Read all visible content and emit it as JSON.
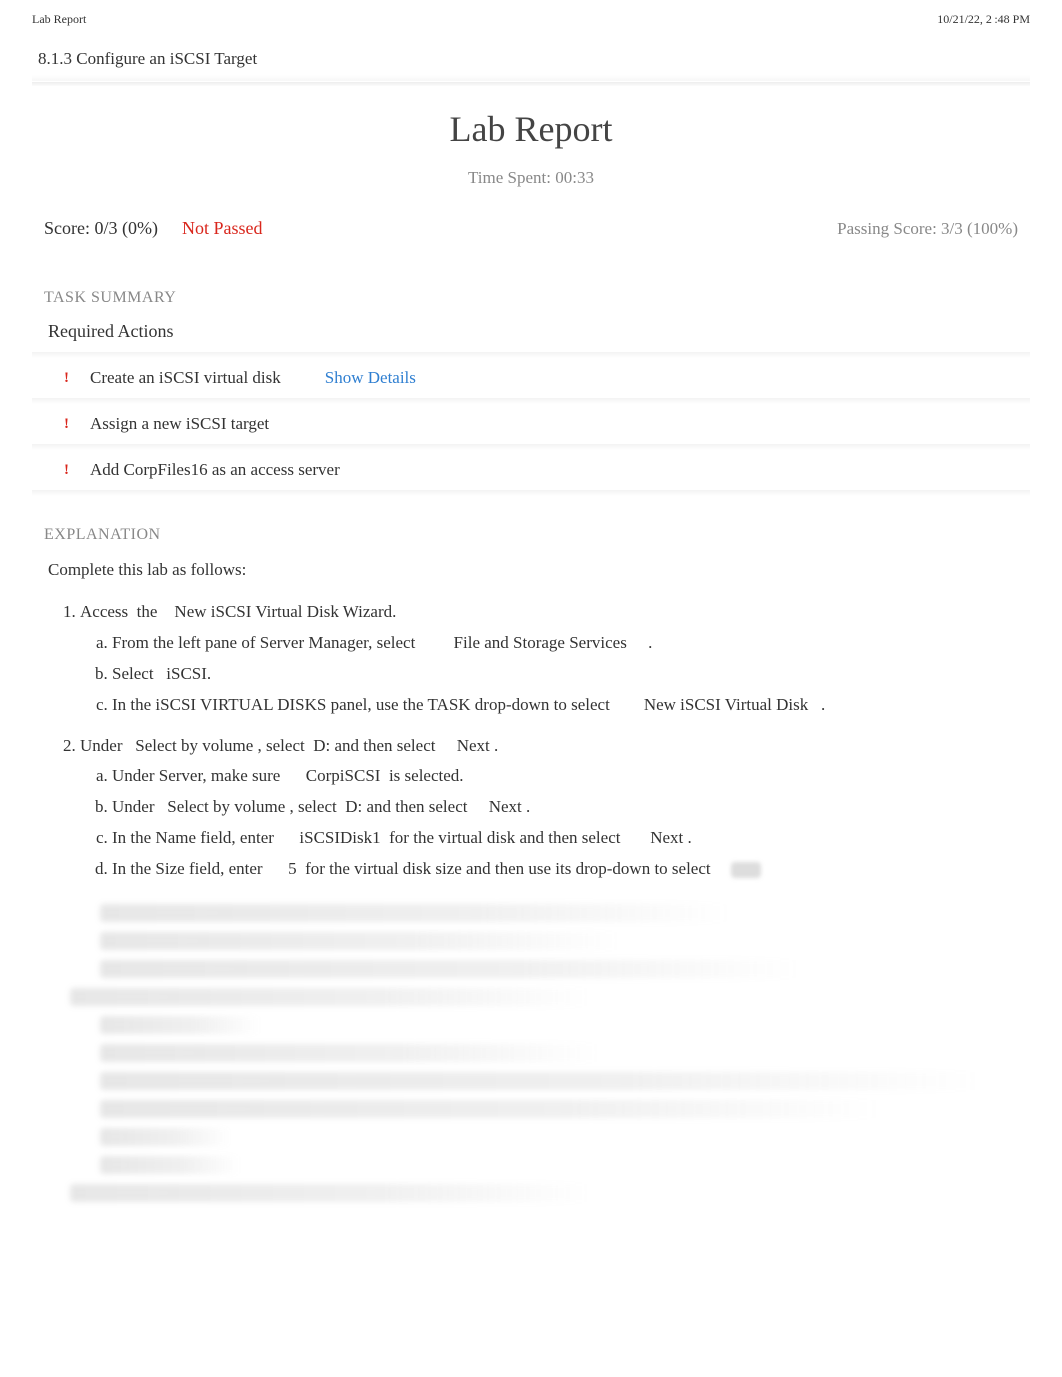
{
  "header": {
    "left": "Lab Report",
    "right": "10/21/22, 2 :48 PM"
  },
  "section_title": "8.1.3 Configure an iSCSI Target",
  "lab_title": "Lab Report",
  "time_spent": "Time Spent: 00:33",
  "score": {
    "text": "Score: 0/3 (0%)",
    "status": "Not Passed",
    "passing": "Passing Score: 3/3 (100%)"
  },
  "task_summary": {
    "heading": "TASK SUMMARY",
    "required_label": "Required Actions",
    "items": [
      {
        "label": "Create an iSCSI virtual disk",
        "details": "Show Details"
      },
      {
        "label": "Assign a new iSCSI target",
        "details": ""
      },
      {
        "label": "Add CorpFiles16 as an access server",
        "details": ""
      }
    ]
  },
  "explanation": {
    "heading": "EXPLANATION",
    "intro": "Complete this lab as follows:",
    "step1": {
      "lead": "Access  the    New iSCSI Virtual Disk Wizard.",
      "a": "From the left pane of Server Manager, select         File and Storage Services     .",
      "b": "Select   iSCSI.",
      "c": "In the iSCSI VIRTUAL DISKS panel, use the TASK drop-down to select        New iSCSI Virtual Disk   ."
    },
    "step2": {
      "lead": "Under   Select by volume , select  D: and then select     Next .",
      "a": "Under Server, make sure      CorpiSCSI  is selected.",
      "b": "Under   Select by volume , select  D: and then select     Next .",
      "c": "In the Name field, enter      iSCSIDisk1  for the virtual disk and then select       Next .",
      "d": "In the Size field, enter      5  for the virtual disk size and then use its drop-down to select"
    }
  }
}
